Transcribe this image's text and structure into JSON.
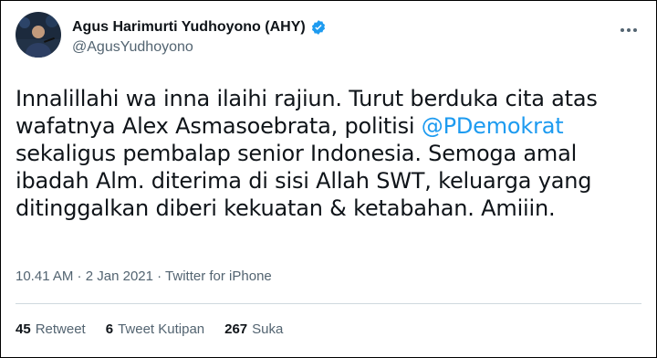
{
  "user": {
    "display_name": "Agus Harimurti Yudhoyono (AHY)",
    "handle": "@AgusYudhoyono",
    "verified_icon": "verified-badge-icon",
    "verified_color": "#1d9bf0"
  },
  "tweet": {
    "text_before_mention": "Innalillahi wa inna ilaihi rajiun. Turut berduka cita atas wafatnya Alex Asmasoebrata, politisi ",
    "mention": "@PDemokrat",
    "text_after_mention": " sekaligus pembalap senior Indonesia. Semoga amal ibadah Alm. diterima di sisi Allah SWT, keluarga yang ditinggalkan diberi kekuatan & ketabahan. Amiiin.",
    "time": "10.41 AM",
    "separator_1": " · ",
    "date": "2 Jan 2021",
    "separator_2": " · ",
    "source": "Twitter for iPhone"
  },
  "stats": {
    "retweets_count": "45",
    "retweets_label": "Retweet",
    "quotes_count": "6",
    "quotes_label": "Tweet Kutipan",
    "likes_count": "267",
    "likes_label": "Suka"
  },
  "colors": {
    "link": "#1d9bf0",
    "secondary_text": "#536471",
    "primary_text": "#0f1419"
  }
}
